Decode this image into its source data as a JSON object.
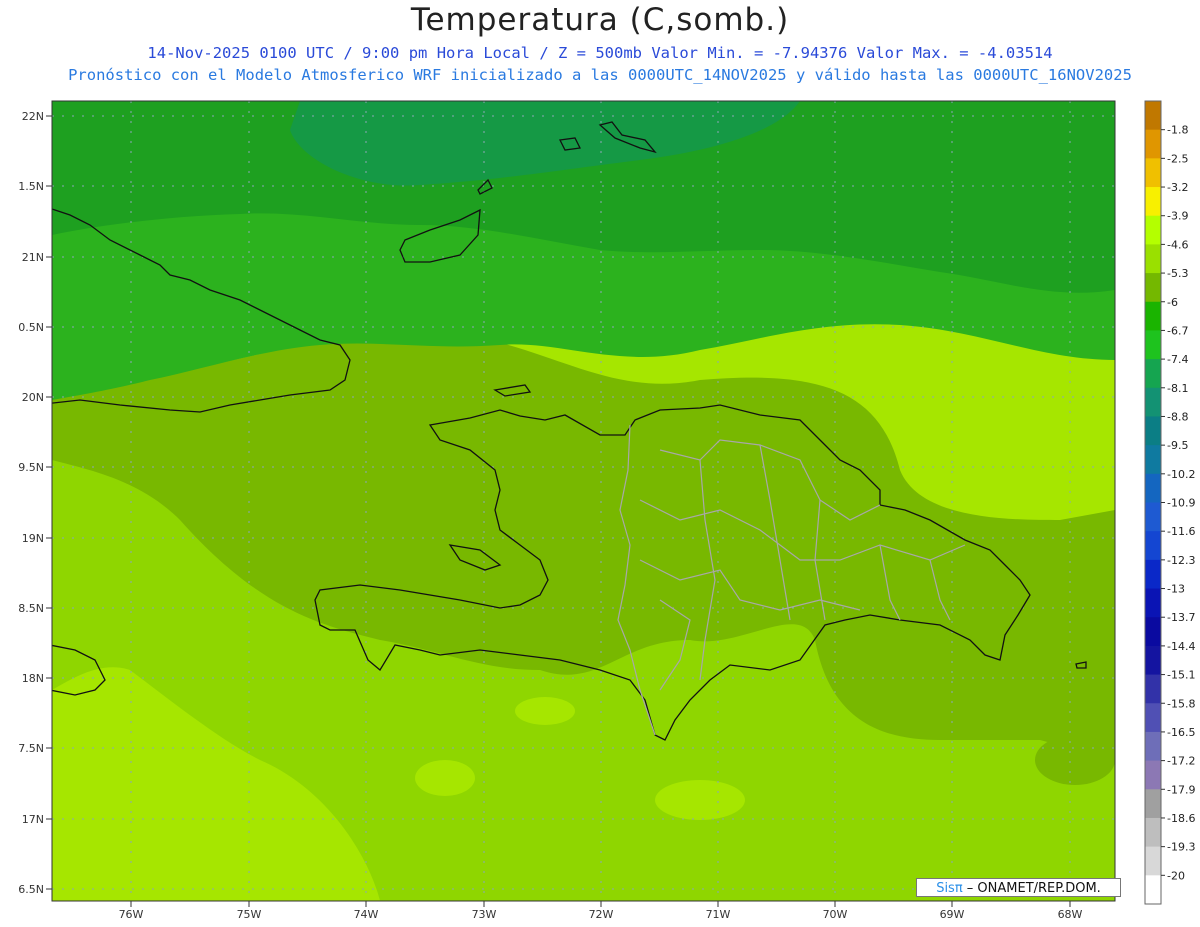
{
  "title": "Temperatura (C,somb.)",
  "subtitle_line1": "14-Nov-2025  0100 UTC / 9:00 pm Hora Local / Z = 500mb  Valor Min. = -7.94376  Valor Max. = -4.03514",
  "subtitle_line2": "Pronóstico con el Modelo Atmosferico WRF inicializado a las 0000UTC_14NOV2025 y válido hasta las  0000UTC_16NOV2025",
  "lat_labels": [
    "22N",
    "1.5N",
    "21N",
    "0.5N",
    "20N",
    "9.5N",
    "19N",
    "8.5N",
    "18N",
    "7.5N",
    "17N",
    "6.5N"
  ],
  "lon_labels": [
    "76W",
    "75W",
    "74W",
    "73W",
    "72W",
    "71W",
    "70W",
    "69W",
    "68W"
  ],
  "colorbar": {
    "labels": [
      "-1.8",
      "-2.5",
      "-3.2",
      "-3.9",
      "-4.6",
      "-5.3",
      "-6",
      "-6.7",
      "-7.4",
      "-8.1",
      "-8.8",
      "-9.5",
      "-10.2",
      "-10.9",
      "-11.6",
      "-12.3",
      "-13",
      "-13.7",
      "-14.4",
      "-15.1",
      "-15.8",
      "-16.5",
      "-17.2",
      "-17.9",
      "-18.6",
      "-19.3",
      "-20"
    ],
    "colors": [
      "#c07800",
      "#e09600",
      "#f0c000",
      "#f8f000",
      "#b4ff00",
      "#9ae000",
      "#74b800",
      "#1ab400",
      "#1ec31e",
      "#15a550",
      "#139273",
      "#0b7e85",
      "#0f7aa0",
      "#1466c0",
      "#1e5ad2",
      "#1446d2",
      "#0a28c8",
      "#0a14b4",
      "#0a0aa0",
      "#1414a0",
      "#3232a8",
      "#5050b4",
      "#6e6eb8",
      "#8c78b4",
      "#a0a0a0",
      "#bebebe",
      "#d8d8d8",
      "#ffffff"
    ]
  },
  "badge": {
    "brand": "Sisπ",
    "text": " – ONAMET/REP.DOM."
  }
}
